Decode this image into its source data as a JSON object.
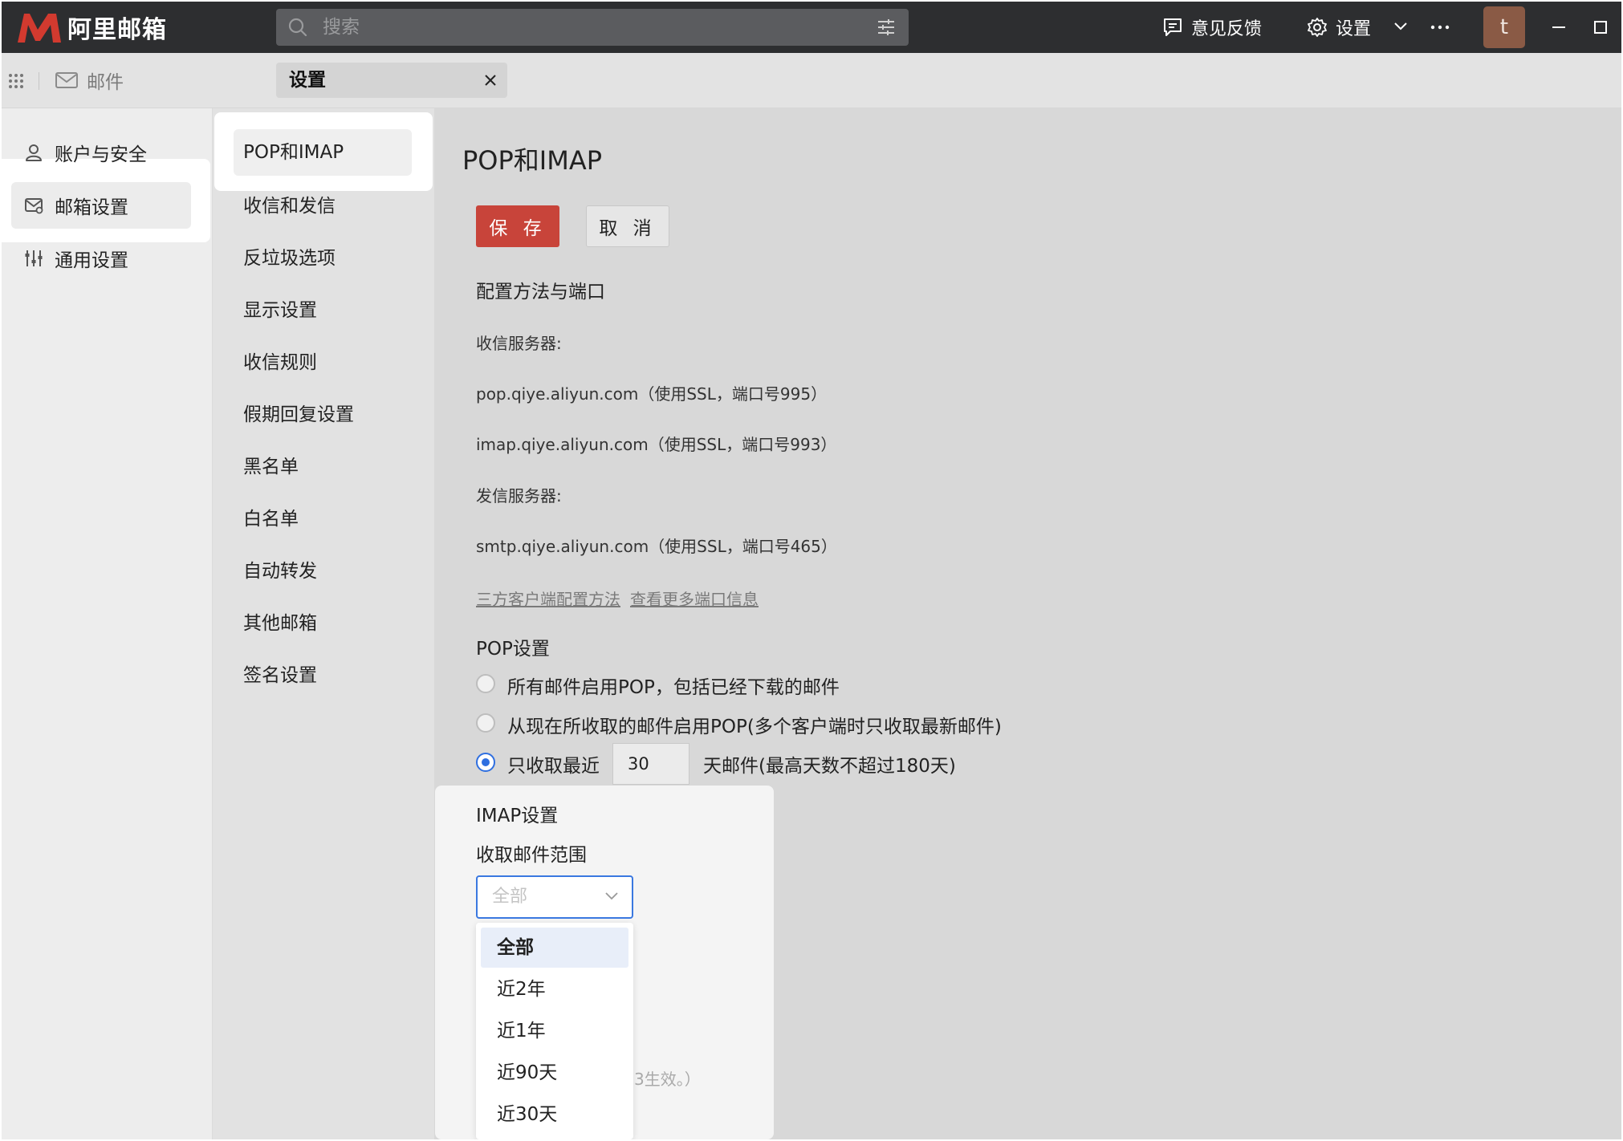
{
  "app": {
    "name": "阿里邮箱",
    "brand_color": "#d23a2f"
  },
  "search": {
    "placeholder": "搜索"
  },
  "topbar": {
    "feedback_label": "意见反馈",
    "settings_label": "设置",
    "avatar_letter": "t"
  },
  "tabs": {
    "mail_label": "邮件",
    "settings_label": "设置"
  },
  "left_nav": {
    "items": [
      {
        "label": "账户与安全",
        "icon": "user-icon"
      },
      {
        "label": "邮箱设置",
        "icon": "mailbox-settings-icon"
      },
      {
        "label": "通用设置",
        "icon": "sliders-icon"
      }
    ]
  },
  "sub_nav": {
    "items": [
      "POP和IMAP",
      "收信和发信",
      "反垃圾选项",
      "显示设置",
      "收信规则",
      "假期回复设置",
      "黑名单",
      "白名单",
      "自动转发",
      "其他邮箱",
      "签名设置"
    ]
  },
  "main": {
    "title": "POP和IMAP",
    "save_label": "保 存",
    "cancel_label": "取 消",
    "config_heading": "配置方法与端口",
    "incoming_label": "收信服务器:",
    "pop_server": "pop.qiye.aliyun.com（使用SSL，端口号995）",
    "imap_server": "imap.qiye.aliyun.com（使用SSL，端口号993）",
    "outgoing_label": "发信服务器:",
    "smtp_server": "smtp.qiye.aliyun.com（使用SSL，端口号465）",
    "link_client_config": "三方客户端配置方法",
    "link_more_ports": "查看更多端口信息",
    "pop_heading": "POP设置",
    "pop_options": [
      {
        "label": "所有邮件启用POP，包括已经下载的邮件",
        "checked": false
      },
      {
        "label": "从现在所收取的邮件启用POP(多个客户端时只收取最新邮件)",
        "checked": false
      },
      {
        "label": "只收取最近",
        "checked": true
      }
    ],
    "days_value": "30",
    "days_suffix": "天邮件(最高天数不超过180天)",
    "imap_heading": "IMAP设置",
    "range_label": "收取邮件范围",
    "range_selected": "全部",
    "range_options": [
      "全部",
      "近2年",
      "近1年",
      "近90天",
      "近30天"
    ],
    "partial_note": "3生效。）"
  }
}
